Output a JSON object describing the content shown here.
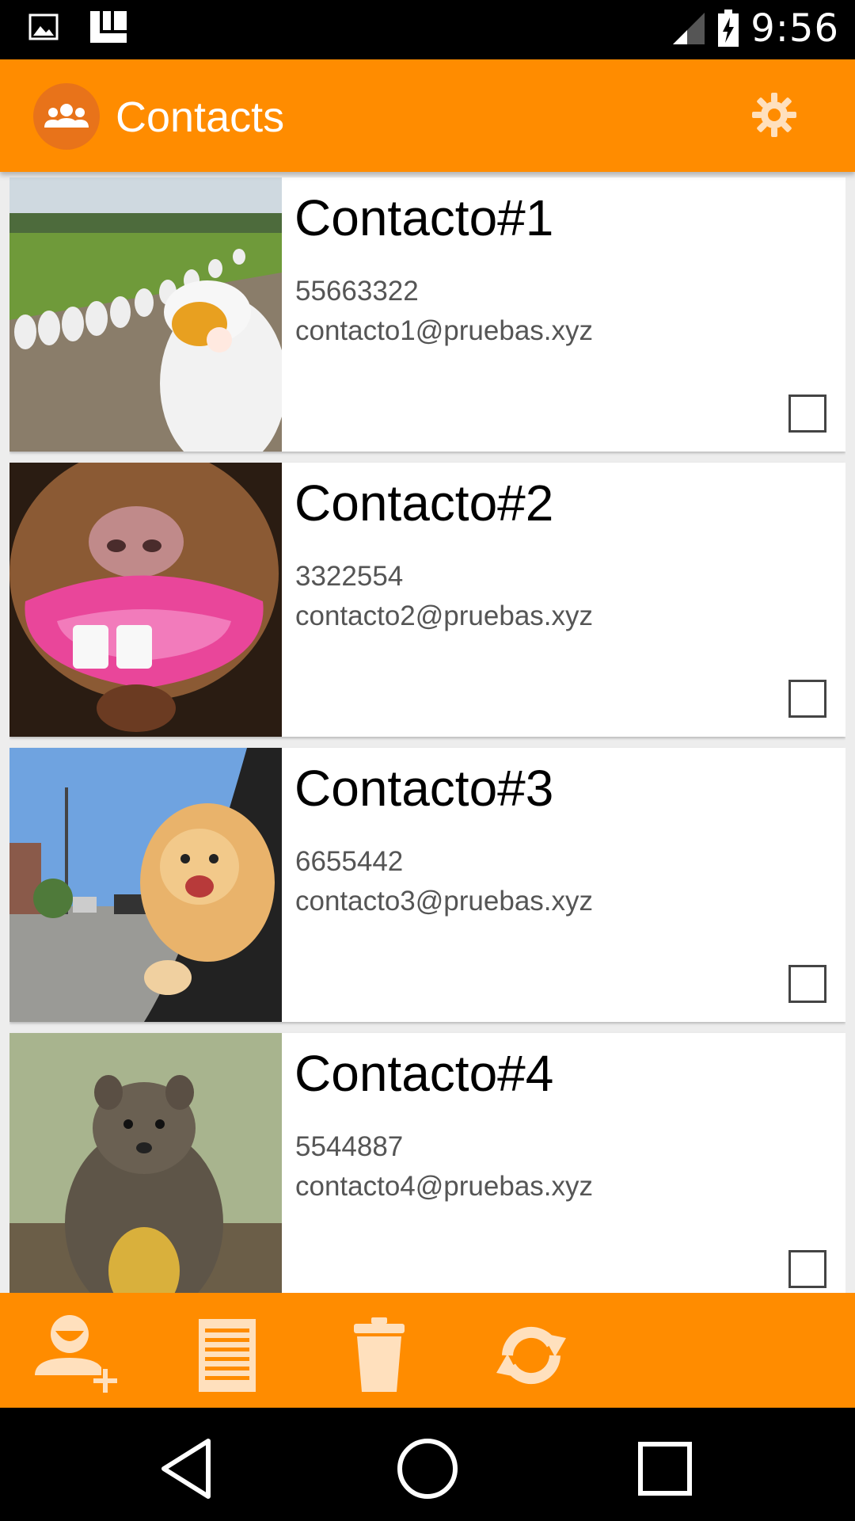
{
  "status_bar": {
    "time": "9:56"
  },
  "app_bar": {
    "title": "Contacts"
  },
  "contacts": [
    {
      "name": "Contacto#1",
      "phone": "55663322",
      "email": "contacto1@pruebas.xyz",
      "checked": false
    },
    {
      "name": "Contacto#2",
      "phone": "3322554",
      "email": "contacto2@pruebas.xyz",
      "checked": false
    },
    {
      "name": "Contacto#3",
      "phone": "6655442",
      "email": "contacto3@pruebas.xyz",
      "checked": false
    },
    {
      "name": "Contacto#4",
      "phone": "5544887",
      "email": "contacto4@pruebas.xyz",
      "checked": false
    }
  ],
  "toolbar": {
    "icons": [
      "add-contact-icon",
      "list-icon",
      "trash-icon",
      "refresh-icon"
    ]
  },
  "colors": {
    "accent": "#ff8c00",
    "logo_bg": "#e8731a",
    "icon_tint": "#ffe0bd"
  }
}
